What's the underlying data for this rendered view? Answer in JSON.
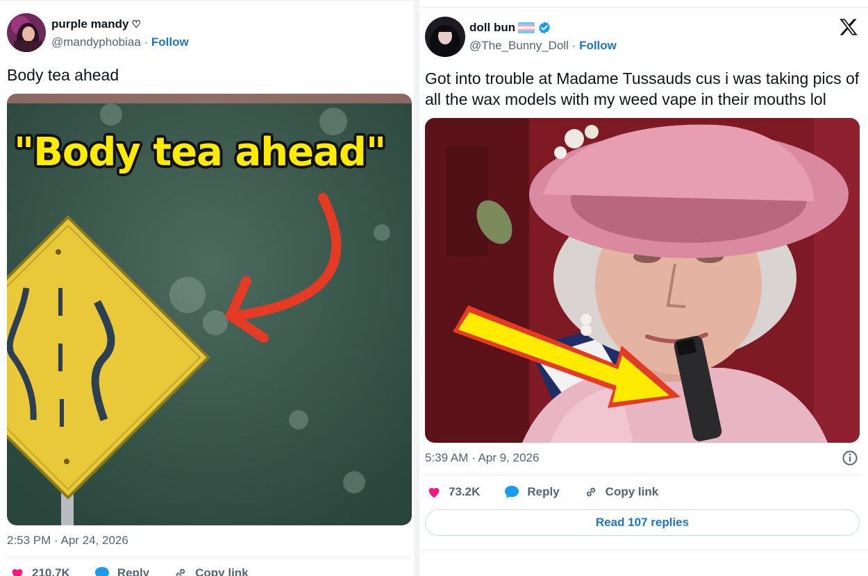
{
  "left_tweet": {
    "display_name": "purple mandy",
    "name_suffix": "♡",
    "handle": "@mandyphobiaa",
    "separator": " · ",
    "follow_label": "Follow",
    "text": "Body tea ahead",
    "media_overlay_caption": "\"Body tea ahead\"",
    "timestamp": "2:53 PM · Apr 24, 2026",
    "likes": "210.7K",
    "reply_label": "Reply",
    "copy_link_label": "Copy link",
    "colors": {
      "sign_yellow": "#e9c83a",
      "arrow_red": "#e53a23"
    }
  },
  "right_tweet": {
    "display_name": "doll bun",
    "handle": "@The_Bunny_Doll",
    "separator": " · ",
    "follow_label": "Follow",
    "verified": true,
    "text": "Got into trouble at Madame Tussauds cus i was taking pics of all the wax models with my weed vape in their mouths lol",
    "timestamp": "5:39 AM · Apr 9, 2026",
    "likes": "73.2K",
    "reply_label": "Reply",
    "copy_link_label": "Copy link",
    "read_replies_label": "Read 107 replies",
    "colors": {
      "arrow_yellow": "#ffeb00",
      "arrow_outline": "#e53a23",
      "verified_blue": "#1d9bf0"
    }
  },
  "icons": [
    "heart-icon",
    "reply-bubble-icon",
    "link-icon",
    "info-icon",
    "x-logo-icon",
    "verified-badge-icon",
    "trans-flag-icon"
  ],
  "colors": {
    "accent": "#1d75c9",
    "heart": "#f91880",
    "text_secondary": "#536471"
  }
}
